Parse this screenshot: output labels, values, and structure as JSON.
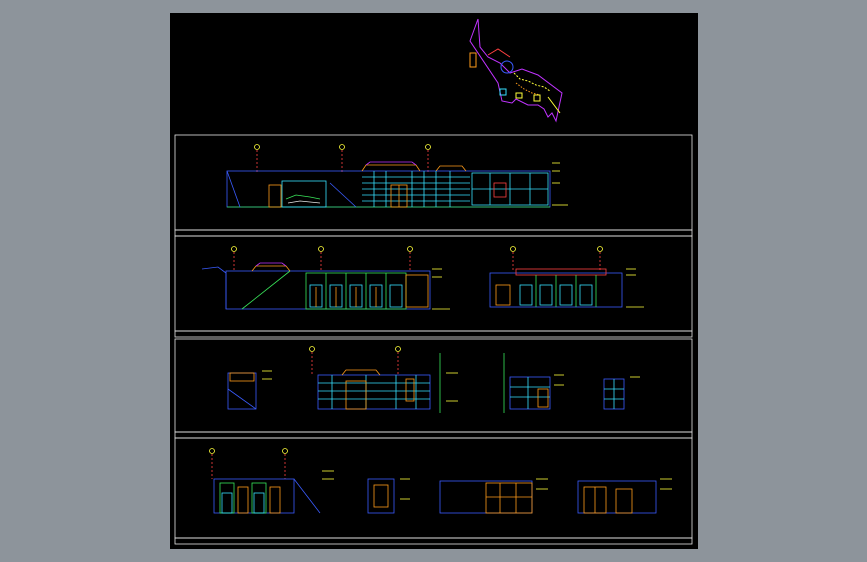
{
  "viewer": {
    "background": "#8d949b",
    "sheet_color": "#000000"
  },
  "palette": {
    "frame": "#e8e8e8",
    "blue": "#3a5cff",
    "cyan": "#36e0ff",
    "green": "#39e65a",
    "yellow": "#ffff3a",
    "orange": "#ff9c1a",
    "magenta": "#c033ff",
    "red": "#ff4040"
  },
  "drawing": {
    "title": "",
    "panels": [
      {
        "id": "row-1",
        "elevations": 1
      },
      {
        "id": "row-2",
        "elevations": 2
      },
      {
        "id": "row-3",
        "elevations": 4
      },
      {
        "id": "row-4",
        "elevations": 4
      }
    ],
    "key_plan": {
      "present": true
    },
    "labels_legible": false
  }
}
